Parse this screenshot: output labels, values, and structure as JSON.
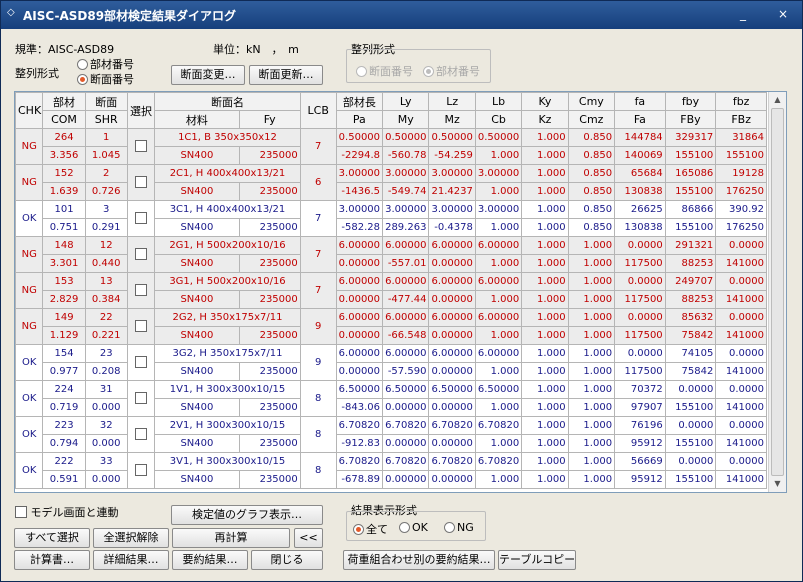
{
  "window": {
    "title": "AISC-ASD89部材検定結果ダイアログ",
    "minimize": "_",
    "close": "×"
  },
  "header": {
    "code_label": "規準：AISC-ASD89",
    "unit_label": "単位：kN　，　m",
    "sort_label": "整列形式",
    "sort_member": "部材番号",
    "sort_section": "断面番号",
    "sort_group_title": "整列形式",
    "sort_group_section": "断面番号",
    "sort_group_member": "部材番号"
  },
  "buttons": {
    "section_change": "断面変更…",
    "section_update": "断面更新…",
    "graph": "検定値のグラフ表示…",
    "select_all": "すべて選択",
    "deselect_all": "全選択解除",
    "recalc": "再計算",
    "collapse": "<<",
    "calc_doc": "計算書…",
    "detail": "詳細結果…",
    "summary": "要約結果…",
    "close": "閉じる",
    "combo_summary": "荷重組合わせ別の要約結果…",
    "table_copy": "テーブルコピー"
  },
  "options": {
    "link_model": "モデル画面と連動",
    "display_title": "結果表示形式",
    "all": "全て",
    "ok": "OK",
    "ng": "NG"
  },
  "table": {
    "h1": [
      "CHK",
      "部材",
      "断面",
      "選択",
      "断面名",
      "LCB",
      "部材長",
      "Ly",
      "Lz",
      "Lb",
      "Ky",
      "Cmy",
      "fa",
      "fby",
      "fbz"
    ],
    "h2": [
      "COM",
      "SHR",
      "材料",
      "Fy",
      "Pa",
      "My",
      "Mz",
      "Cb",
      "Kz",
      "Cmz",
      "Fa",
      "FBy",
      "FBz"
    ],
    "rows": [
      {
        "chk": "NG",
        "elem": "264",
        "sec": "1",
        "com": "3.356",
        "shr": "1.045",
        "name": "1C1, B 350x350x12",
        "mat": "SN400",
        "fy": "235000",
        "lcb": "7",
        "r1": [
          "0.50000",
          "0.50000",
          "0.50000",
          "0.50000",
          "1.000",
          "0.850",
          "144784",
          "329317",
          "31864"
        ],
        "r2": [
          "-2294.8",
          "-560.78",
          "-54.259",
          "1.000",
          "1.000",
          "0.850",
          "140069",
          "155100",
          "155100"
        ]
      },
      {
        "chk": "NG",
        "elem": "152",
        "sec": "2",
        "com": "1.639",
        "shr": "0.726",
        "name": "2C1, H 400x400x13/21",
        "mat": "SN400",
        "fy": "235000",
        "lcb": "6",
        "r1": [
          "3.00000",
          "3.00000",
          "3.00000",
          "3.00000",
          "1.000",
          "0.850",
          "65684",
          "165086",
          "19128"
        ],
        "r2": [
          "-1436.5",
          "-549.74",
          "21.4237",
          "1.000",
          "1.000",
          "0.850",
          "130838",
          "155100",
          "176250"
        ]
      },
      {
        "chk": "OK",
        "elem": "101",
        "sec": "3",
        "com": "0.751",
        "shr": "0.291",
        "name": "3C1, H 400x400x13/21",
        "mat": "SN400",
        "fy": "235000",
        "lcb": "7",
        "r1": [
          "3.00000",
          "3.00000",
          "3.00000",
          "3.00000",
          "1.000",
          "0.850",
          "26625",
          "86866",
          "390.92"
        ],
        "r2": [
          "-582.28",
          "289.263",
          "-0.4378",
          "1.000",
          "1.000",
          "0.850",
          "130838",
          "155100",
          "176250"
        ]
      },
      {
        "chk": "NG",
        "elem": "148",
        "sec": "12",
        "com": "3.301",
        "shr": "0.440",
        "name": "2G1, H 500x200x10/16",
        "mat": "SN400",
        "fy": "235000",
        "lcb": "7",
        "r1": [
          "6.00000",
          "6.00000",
          "6.00000",
          "6.00000",
          "1.000",
          "1.000",
          "0.0000",
          "291321",
          "0.0000"
        ],
        "r2": [
          "0.00000",
          "-557.01",
          "0.00000",
          "1.000",
          "1.000",
          "1.000",
          "117500",
          "88253",
          "141000"
        ]
      },
      {
        "chk": "NG",
        "elem": "153",
        "sec": "13",
        "com": "2.829",
        "shr": "0.384",
        "name": "3G1, H 500x200x10/16",
        "mat": "SN400",
        "fy": "235000",
        "lcb": "7",
        "r1": [
          "6.00000",
          "6.00000",
          "6.00000",
          "6.00000",
          "1.000",
          "1.000",
          "0.0000",
          "249707",
          "0.0000"
        ],
        "r2": [
          "0.00000",
          "-477.44",
          "0.00000",
          "1.000",
          "1.000",
          "1.000",
          "117500",
          "88253",
          "141000"
        ]
      },
      {
        "chk": "NG",
        "elem": "149",
        "sec": "22",
        "com": "1.129",
        "shr": "0.221",
        "name": "2G2, H 350x175x7/11",
        "mat": "SN400",
        "fy": "235000",
        "lcb": "9",
        "r1": [
          "6.00000",
          "6.00000",
          "6.00000",
          "6.00000",
          "1.000",
          "1.000",
          "0.0000",
          "85632",
          "0.0000"
        ],
        "r2": [
          "0.00000",
          "-66.548",
          "0.00000",
          "1.000",
          "1.000",
          "1.000",
          "117500",
          "75842",
          "141000"
        ]
      },
      {
        "chk": "OK",
        "elem": "154",
        "sec": "23",
        "com": "0.977",
        "shr": "0.208",
        "name": "3G2, H 350x175x7/11",
        "mat": "SN400",
        "fy": "235000",
        "lcb": "9",
        "r1": [
          "6.00000",
          "6.00000",
          "6.00000",
          "6.00000",
          "1.000",
          "1.000",
          "0.0000",
          "74105",
          "0.0000"
        ],
        "r2": [
          "0.00000",
          "-57.590",
          "0.00000",
          "1.000",
          "1.000",
          "1.000",
          "117500",
          "75842",
          "141000"
        ]
      },
      {
        "chk": "OK",
        "elem": "224",
        "sec": "31",
        "com": "0.719",
        "shr": "0.000",
        "name": "1V1, H 300x300x10/15",
        "mat": "SN400",
        "fy": "235000",
        "lcb": "8",
        "r1": [
          "6.50000",
          "6.50000",
          "6.50000",
          "6.50000",
          "1.000",
          "1.000",
          "70372",
          "0.0000",
          "0.0000"
        ],
        "r2": [
          "-843.06",
          "0.00000",
          "0.00000",
          "1.000",
          "1.000",
          "1.000",
          "97907",
          "155100",
          "141000"
        ]
      },
      {
        "chk": "OK",
        "elem": "223",
        "sec": "32",
        "com": "0.794",
        "shr": "0.000",
        "name": "2V1, H 300x300x10/15",
        "mat": "SN400",
        "fy": "235000",
        "lcb": "8",
        "r1": [
          "6.70820",
          "6.70820",
          "6.70820",
          "6.70820",
          "1.000",
          "1.000",
          "76196",
          "0.0000",
          "0.0000"
        ],
        "r2": [
          "-912.83",
          "0.00000",
          "0.00000",
          "1.000",
          "1.000",
          "1.000",
          "95912",
          "155100",
          "141000"
        ]
      },
      {
        "chk": "OK",
        "elem": "222",
        "sec": "33",
        "com": "0.591",
        "shr": "0.000",
        "name": "3V1, H 300x300x10/15",
        "mat": "SN400",
        "fy": "235000",
        "lcb": "8",
        "r1": [
          "6.70820",
          "6.70820",
          "6.70820",
          "6.70820",
          "1.000",
          "1.000",
          "56669",
          "0.0000",
          "0.0000"
        ],
        "r2": [
          "-678.89",
          "0.00000",
          "0.00000",
          "1.000",
          "1.000",
          "1.000",
          "95912",
          "155100",
          "141000"
        ]
      }
    ]
  }
}
